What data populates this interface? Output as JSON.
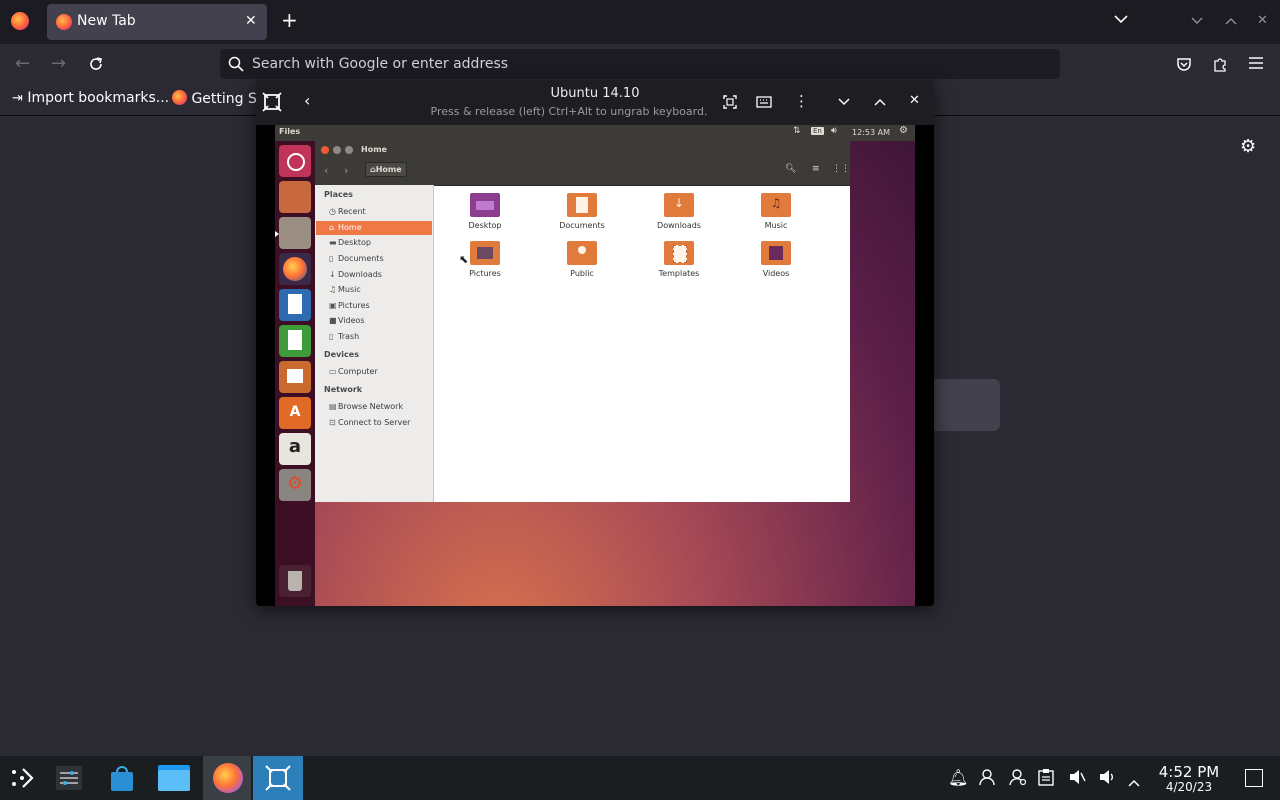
{
  "browser": {
    "tab_title": "New Tab",
    "url_placeholder": "Search with Google or enter address",
    "bookmarks": [
      "Import bookmarks...",
      "Getting St"
    ]
  },
  "vm": {
    "title": "Ubuntu 14.10",
    "subtitle": "Press & release (left) Ctrl+Alt to ungrab keyboard."
  },
  "guest": {
    "panel_app": "Files",
    "panel_lang": "En",
    "panel_time": "12:53 AM",
    "nautilus": {
      "title": "Home",
      "path_button": "Home",
      "sidebar": {
        "places_header": "Places",
        "places": [
          "Recent",
          "Home",
          "Desktop",
          "Documents",
          "Downloads",
          "Music",
          "Pictures",
          "Videos",
          "Trash"
        ],
        "devices_header": "Devices",
        "devices": [
          "Computer"
        ],
        "network_header": "Network",
        "network": [
          "Browse Network",
          "Connect to Server"
        ]
      },
      "folders": [
        "Desktop",
        "Documents",
        "Downloads",
        "Music",
        "Pictures",
        "Public",
        "Templates",
        "Videos"
      ]
    }
  },
  "taskbar": {
    "time": "4:52 PM",
    "date": "4/20/23"
  },
  "colors": {
    "ubuntu_orange": "#f07746",
    "firefox_bg": "#2b2a33",
    "taskbar_bg": "#1b1e20"
  }
}
